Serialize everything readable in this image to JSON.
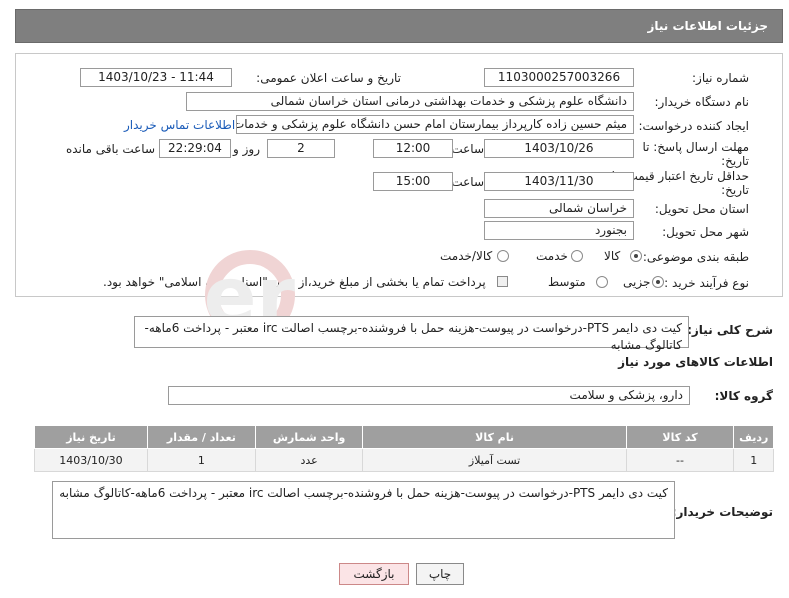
{
  "header": {
    "title": "جزئیات اطلاعات نیاز"
  },
  "form": {
    "need_number_label": "شماره نیاز:",
    "need_number": "1103000257003266",
    "announce_label": "تاریخ و ساعت اعلان عمومی:",
    "announce_value": "1403/10/23 - 11:44",
    "buyer_org_label": "نام دستگاه خریدار:",
    "buyer_org": "دانشگاه علوم پزشکی و خدمات بهداشتی درمانی استان خراسان شمالی",
    "creator_label": "ایجاد کننده درخواست:",
    "creator": "میثم  حسین زاده  کارپرداز بیمارستان امام حسن دانشگاه علوم پزشکی و خدمات",
    "contact_link": "اطلاعات تماس خریدار",
    "send_deadline_label_1": "مهلت ارسال پاسخ: تا",
    "send_deadline_label_2": "تاریخ:",
    "send_date": "1403/10/26",
    "time_label": "ساعت",
    "send_time": "12:00",
    "days_value": "2",
    "days_label": "روز و",
    "remaining_time": "22:29:04",
    "remaining_label": "ساعت باقی مانده",
    "validity_label_1": "حداقل تاریخ اعتبار قیمت: تا",
    "validity_label_2": "تاریخ:",
    "validity_date": "1403/11/30",
    "validity_time_label": "ساعت",
    "validity_time": "15:00",
    "province_label": "استان محل تحویل:",
    "province": "خراسان شمالی",
    "city_label": "شهر محل تحویل:",
    "city": "بجنورد",
    "category_label": "طبقه بندی موضوعی:",
    "category_options": [
      "کالا",
      "خدمت",
      "کالا/خدمت"
    ],
    "process_label": "نوع فرآیند خرید :",
    "process_options": [
      "جزیی",
      "متوسط"
    ],
    "payment_note": "پرداخت تمام یا بخشی از مبلغ خرید،از محل \"اسناد خزانه اسلامی\" خواهد بود."
  },
  "summary": {
    "label": "شرح کلی نیاز:",
    "text": "کیت دی دایمر PTS-درخواست در پیوست-هزینه حمل با فروشنده-برچسب اصالت irc معتبر - پرداخت 6ماهه-کاتالوگ مشابه"
  },
  "goods_section": {
    "title": "اطلاعات کالاهای مورد نیاز",
    "group_label": "گروه کالا:",
    "group_value": "دارو، پزشکی و سلامت"
  },
  "table": {
    "headers": [
      "ردیف",
      "کد کالا",
      "نام کالا",
      "واحد شمارش",
      "تعداد / مقدار",
      "تاریخ نیاز"
    ],
    "rows": [
      [
        "1",
        "--",
        "تست آمیلاز",
        "عدد",
        "1",
        "1403/10/30"
      ]
    ]
  },
  "buyer_notes": {
    "label": "توضیحات خریدار:",
    "text": "کیت دی دایمر PTS-درخواست در پیوست-هزینه حمل با فروشنده-برچسب اصالت irc معتبر - پرداخت 6ماهه-کاتالوگ مشابه"
  },
  "buttons": {
    "print": "چاپ",
    "back": "بازگشت"
  },
  "colors": {
    "header_bg": "#7f7f7f",
    "table_header_bg": "#9f9f9f",
    "link": "#1a5bb8",
    "back_btn_bg": "#fbe4e6"
  }
}
